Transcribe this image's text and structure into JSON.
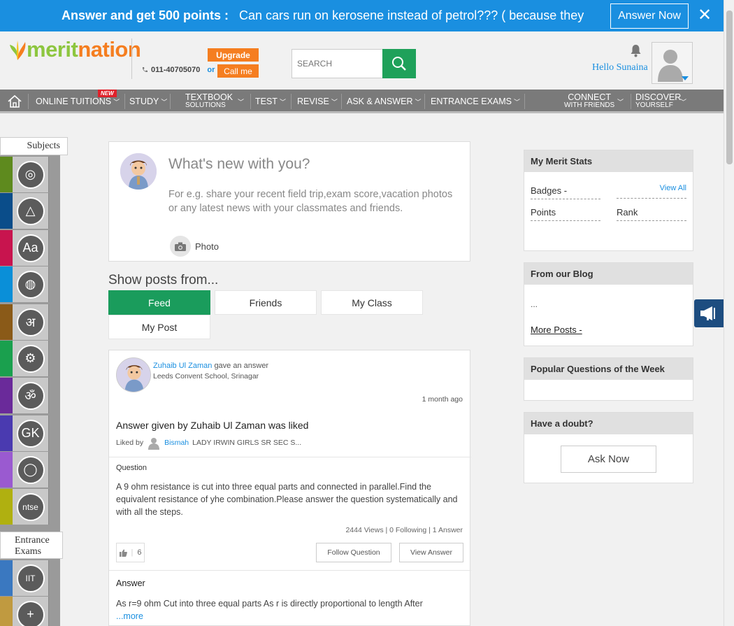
{
  "topbar": {
    "lead": "Answer and get 500 points :",
    "question": "Can cars run on kerosene instead of petrol??? ( because they",
    "answer_button": "Answer Now",
    "close": "✕"
  },
  "header": {
    "logo_text_a": "merit",
    "logo_text_b": "nation",
    "upgrade": "Upgrade",
    "phone": "011-40705070",
    "or": "or",
    "call_me": "Call me",
    "search_placeholder": "SEARCH",
    "greeting": "Hello Sunaina"
  },
  "nav": {
    "new_badge": "NEW",
    "online_tuitions": "ONLINE TUITIONS",
    "study": "STUDY",
    "textbook": "TEXTBOOK",
    "textbook_sub": "SOLUTIONS",
    "test": "TEST",
    "revise": "REVISE",
    "ask_answer": "ASK & ANSWER",
    "entrance": "ENTRANCE EXAMS",
    "connect": "CONNECT",
    "connect_sub": "WITH FRIENDS",
    "discover": "DISCOVER",
    "discover_sub": "YOURSELF"
  },
  "rail": {
    "subjects_label": "Subjects",
    "entrance_label_1": "Entrance",
    "entrance_label_2": "Exams",
    "colors": [
      "#5e8a1e",
      "#0a4d8a",
      "#c8144e",
      "#0a8fd8",
      "#8a5a18",
      "#1aa04e",
      "#6a2a9a",
      "#4a3ab0",
      "#9a5ad0",
      "#b0b010",
      "#3a78c0",
      "#c09a40"
    ]
  },
  "composer": {
    "title": "What's new with you?",
    "hint": "For e.g. share your recent field trip,exam score,vacation photos or any latest news with your classmates and friends.",
    "photo": "Photo"
  },
  "show_posts": {
    "title": "Show posts from...",
    "tabs": [
      "Feed",
      "Friends",
      "My Class",
      "My Post"
    ]
  },
  "post": {
    "author": "Zuhaib Ul Zaman",
    "action": "gave an answer",
    "school": "Leeds Convent School, Srinagar",
    "time": "1 month ago",
    "liked_title": "Answer given by Zuhaib Ul Zaman was liked",
    "liked_by": "Liked by",
    "liker": "Bismah",
    "liker_school": "LADY IRWIN GIRLS SR SEC S...",
    "question_label": "Question",
    "question": "A 9 ohm resistance is cut into three equal parts and connected in parallel.Find the equivalent resistance of yhe combination.Please answer the question systematically and with all the steps.",
    "stats": "2444 Views   |   0 Following   |   1 Answer",
    "likes": "6",
    "follow": "Follow Question",
    "view_answer": "View Answer",
    "answer_label": "Answer",
    "answer": "As r=9 ohm Cut into three equal parts As r is directly proportional to length After",
    "more": "...more"
  },
  "right": {
    "stats_title": "My Merit Stats",
    "badges": "Badges -",
    "view_all": "View All",
    "points": "Points",
    "rank": "Rank",
    "blog_title": "From our Blog",
    "blog_dots": "...",
    "more_posts": "More Posts -",
    "popular_title": "Popular Questions of the Week",
    "doubt_title": "Have a doubt?",
    "ask_now": "Ask Now"
  }
}
